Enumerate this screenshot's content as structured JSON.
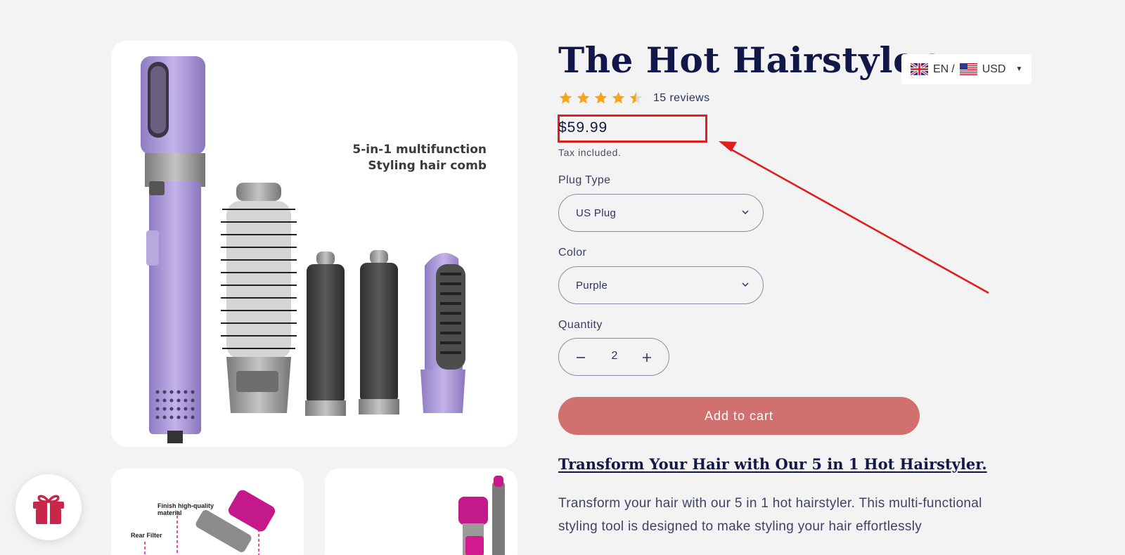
{
  "product": {
    "title": "The Hot Hairstyler",
    "rating": 4.5,
    "rating_max": 5,
    "review_count_label": "15 reviews",
    "price": "$59.99",
    "tax_note": "Tax included."
  },
  "gallery": {
    "main_image_caption_line1": "5-in-1 multifunction",
    "main_image_caption_line2": "Styling hair comb",
    "thumb1_caption_line1": "Finish high-quality",
    "thumb1_caption_line2": "material",
    "thumb1_caption_line3": "Rear Filter"
  },
  "locale": {
    "language": "EN",
    "separator": "/",
    "currency": "USD"
  },
  "options": {
    "plug_label": "Plug Type",
    "plug_value": "US Plug",
    "color_label": "Color",
    "color_value": "Purple",
    "quantity_label": "Quantity",
    "quantity_value": "2"
  },
  "actions": {
    "add_to_cart": "Add to cart"
  },
  "description": {
    "heading": "Transform Your Hair with Our 5 in 1 Hot Hairstyler.",
    "body": "Transform your hair with our 5 in 1 hot hairstyler. This multi-functional styling tool is designed to make styling your hair effortlessly"
  },
  "colors": {
    "title": "#12174a",
    "star": "#f5a51c",
    "add_to_cart_bg": "#d0706f",
    "annotation_red": "#e21d1d",
    "gift": "#c8264b"
  },
  "icons": [
    "uk-flag-icon",
    "us-flag-icon",
    "caret-down-icon",
    "star-icon",
    "chevron-down-icon",
    "minus-icon",
    "plus-icon",
    "gift-icon",
    "arrow-annotation"
  ]
}
